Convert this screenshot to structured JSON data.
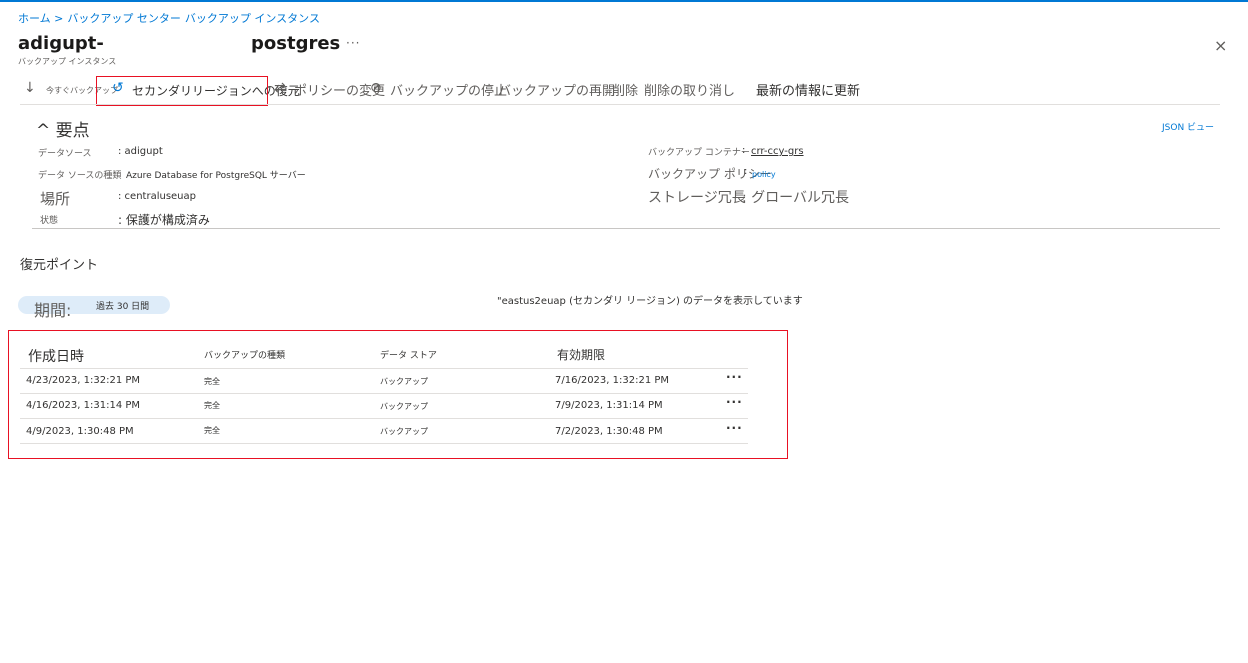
{
  "breadcrumb": [
    "ホーム >",
    "バックアップ センター",
    "バックアップ インスタンス"
  ],
  "header": {
    "title_left": "adigupt-",
    "title_right": "postgres",
    "more": "···",
    "subtitle": "バックアップ インスタンス",
    "close": "×"
  },
  "toolbar": {
    "backup_now": "今すぐバックアップ",
    "restore_secondary": "セカンダリリージョンへの復元",
    "change_policy": "ポリシーの変更",
    "stop_backup": "バックアップの停止",
    "resume_backup": "バックアップの再開",
    "delete": "削除",
    "undelete": "削除の取り消し",
    "refresh": "最新の情報に更新"
  },
  "essentials": {
    "heading": "要点",
    "json_view": "JSON ビュー",
    "left": [
      {
        "label": "データソース",
        "value": ": adigupt"
      },
      {
        "label": "データ ソースの種類",
        "value": "Azure Database for PostgreSQL サーバー"
      },
      {
        "label": "場所",
        "value": ": centraluseuap"
      },
      {
        "label": "状態",
        "value": ": 保護が構成済み"
      }
    ],
    "right": [
      {
        "label": "バックアップ コンテナー",
        "value": "crr-ccy-grs"
      },
      {
        "label": "バックアップ ポリシー",
        "value": "policy"
      },
      {
        "label": "ストレージ冗長",
        "value": ": グローバル冗長"
      }
    ]
  },
  "restore_points": {
    "title": "復元ポイント",
    "period_label": "期間:",
    "period_value": "過去 30 日間",
    "region_note": "\"eastus2euap (セカンダリ リージョン) のデータを表示しています",
    "columns": [
      "作成日時",
      "バックアップの種類",
      "データ ストア",
      "有効期限"
    ],
    "rows": [
      {
        "created": "4/23/2023, 1:32:21 PM",
        "type": "完全",
        "store": "バックアップ",
        "expiry": "7/16/2023, 1:32:21 PM"
      },
      {
        "created": "4/16/2023, 1:31:14 PM",
        "type": "完全",
        "store": "バックアップ",
        "expiry": "7/9/2023, 1:31:14 PM"
      },
      {
        "created": "4/9/2023, 1:30:48 PM",
        "type": "完全",
        "store": "バックアップ",
        "expiry": "7/2/2023, 1:30:48 PM"
      }
    ],
    "row_more": "···"
  },
  "icons": {
    "download": "↓",
    "restore": "↺",
    "change": "⇄",
    "stop": "⊘",
    "trash": "🗑",
    "chevron": "^"
  },
  "colors": {
    "accent": "#0078d4",
    "highlight": "#e81123"
  }
}
